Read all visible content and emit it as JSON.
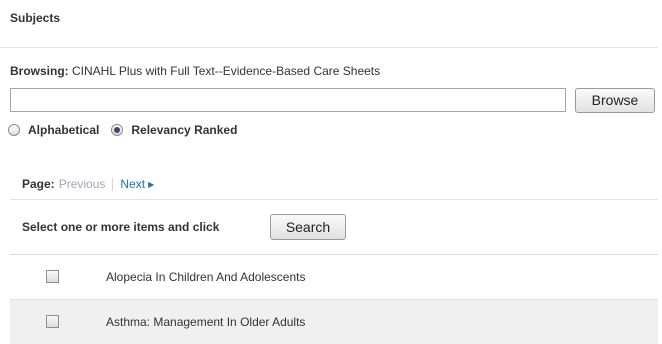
{
  "heading": "Subjects",
  "browsing": {
    "label": "Browsing:",
    "database": "CINAHL Plus with Full Text--Evidence-Based Care Sheets"
  },
  "term_input": {
    "value": ""
  },
  "browse_button": "Browse",
  "sort_options": [
    {
      "label": "Alphabetical",
      "checked": false
    },
    {
      "label": "Relevancy Ranked",
      "checked": true
    }
  ],
  "pager": {
    "label": "Page:",
    "previous": "Previous",
    "next": "Next"
  },
  "select_prompt": "Select one or more items and click",
  "search_button": "Search",
  "items": [
    {
      "label": "Alopecia In Children And Adolescents",
      "checked": false
    },
    {
      "label": "Asthma: Management In Older Adults",
      "checked": false
    }
  ],
  "colors": {
    "link": "#1e6fb8",
    "disabled_link": "#9aa7b4",
    "alt_row": "#f0f0f0"
  }
}
